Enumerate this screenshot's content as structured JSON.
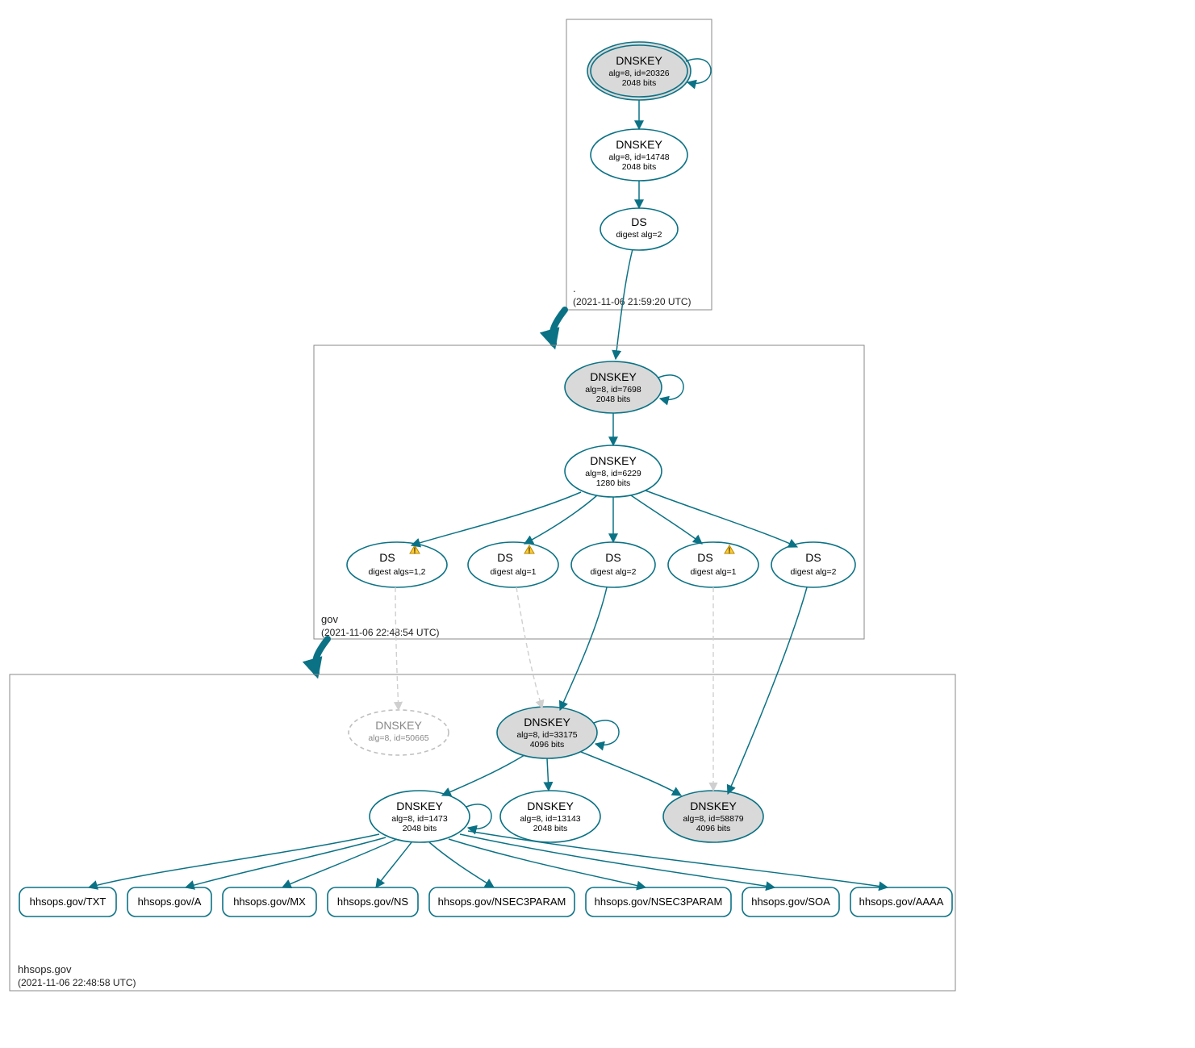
{
  "colors": {
    "teal": "#0b7285",
    "node_fill_gray": "#d9d9d9",
    "dashed_gray": "#bfbfbf",
    "warn_yellow": "#ffcc33"
  },
  "zones": {
    "root": {
      "label": ".",
      "timestamp": "(2021-11-06 21:59:20 UTC)"
    },
    "gov": {
      "label": "gov",
      "timestamp": "(2021-11-06 22:48:54 UTC)"
    },
    "hhsops": {
      "label": "hhsops.gov",
      "timestamp": "(2021-11-06 22:48:58 UTC)"
    }
  },
  "nodes": {
    "root_ksk": {
      "title": "DNSKEY",
      "l2": "alg=8, id=20326",
      "l3": "2048 bits"
    },
    "root_zsk": {
      "title": "DNSKEY",
      "l2": "alg=8, id=14748",
      "l3": "2048 bits"
    },
    "root_ds": {
      "title": "DS",
      "l2": "digest alg=2",
      "l3": ""
    },
    "gov_ksk": {
      "title": "DNSKEY",
      "l2": "alg=8, id=7698",
      "l3": "2048 bits"
    },
    "gov_zsk": {
      "title": "DNSKEY",
      "l2": "alg=8, id=6229",
      "l3": "1280 bits"
    },
    "gov_ds1": {
      "title": "DS",
      "l2": "digest algs=1,2",
      "l3": "",
      "warn": true
    },
    "gov_ds2": {
      "title": "DS",
      "l2": "digest alg=1",
      "l3": "",
      "warn": true
    },
    "gov_ds3": {
      "title": "DS",
      "l2": "digest alg=2",
      "l3": ""
    },
    "gov_ds4": {
      "title": "DS",
      "l2": "digest alg=1",
      "l3": "",
      "warn": true
    },
    "gov_ds5": {
      "title": "DS",
      "l2": "digest alg=2",
      "l3": ""
    },
    "hh_dk_dashed": {
      "title": "DNSKEY",
      "l2": "alg=8, id=50665",
      "l3": ""
    },
    "hh_ksk": {
      "title": "DNSKEY",
      "l2": "alg=8, id=33175",
      "l3": "4096 bits"
    },
    "hh_zsk": {
      "title": "DNSKEY",
      "l2": "alg=8, id=1473",
      "l3": "2048 bits"
    },
    "hh_dk2": {
      "title": "DNSKEY",
      "l2": "alg=8, id=13143",
      "l3": "2048 bits"
    },
    "hh_dk3": {
      "title": "DNSKEY",
      "l2": "alg=8, id=58879",
      "l3": "4096 bits"
    }
  },
  "rrnodes": [
    "hhsops.gov/TXT",
    "hhsops.gov/A",
    "hhsops.gov/MX",
    "hhsops.gov/NS",
    "hhsops.gov/NSEC3PARAM",
    "hhsops.gov/NSEC3PARAM",
    "hhsops.gov/SOA",
    "hhsops.gov/AAAA"
  ]
}
